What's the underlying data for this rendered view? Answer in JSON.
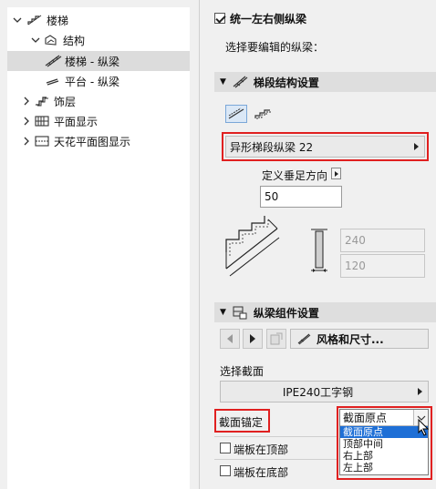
{
  "tree": {
    "items": [
      {
        "label": "楼梯",
        "icon": "stair-icon",
        "expanded": true,
        "level": 0
      },
      {
        "label": "结构",
        "icon": "structure-icon",
        "expanded": true,
        "level": 1
      },
      {
        "label": "楼梯 - 纵梁",
        "icon": "stringer-icon",
        "selected": true,
        "level": 2
      },
      {
        "label": "平台 - 纵梁",
        "icon": "landing-icon",
        "level": 2
      },
      {
        "label": "饰层",
        "icon": "finish-icon",
        "expanded": false,
        "level": 1
      },
      {
        "label": "平面显示",
        "icon": "floorplan-icon",
        "expanded": false,
        "level": 1
      },
      {
        "label": "天花平面图显示",
        "icon": "ceiling-icon",
        "expanded": false,
        "level": 1
      }
    ]
  },
  "panel": {
    "unify_label": "统一左右侧纵梁",
    "unify_checked": true,
    "select_label": "选择要编辑的纵梁：",
    "section1_title": "梯段结构设置",
    "stringer_type": "异形梯段纵梁 22",
    "perp_label": "定义垂足方向",
    "perp_value": "50",
    "dim_top": "240",
    "dim_bottom": "120",
    "section2_title": "纵梁组件设置",
    "style_label": "风格和尺寸...",
    "profile_label": "选择截面",
    "profile_value": "IPE240工字钢",
    "anchor_label": "截面锚定",
    "anchor_selected": "截面原点",
    "anchor_options": [
      "截面原点",
      "顶部中间",
      "右上部",
      "左上部"
    ],
    "endplate_top": "端板在顶部",
    "endplate_bottom": "端板在底部"
  },
  "colors": {
    "highlight_red": "#e02020",
    "selection_blue": "#1e6fd6",
    "tree_selected": "#dcdcdc"
  }
}
